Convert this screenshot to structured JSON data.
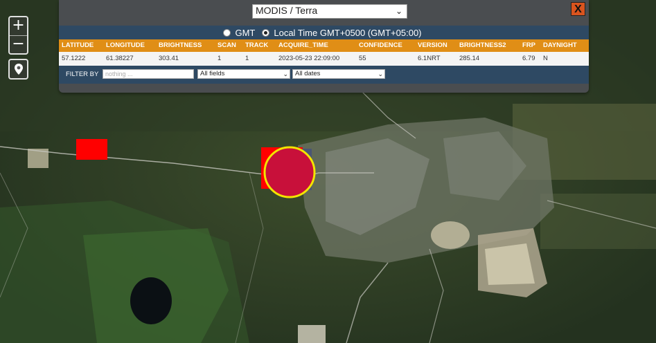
{
  "map": {
    "zoom_in_label": "+",
    "zoom_out_label": "−",
    "location_icon": "map-marker-icon",
    "fire_color": "#ff0000",
    "highlight_color": "#c8103a",
    "highlight_ring_color": "#f3e400"
  },
  "panel": {
    "source_select": "MODIS / Terra",
    "close_label": "X",
    "timezone": {
      "gmt_label": "GMT",
      "local_label": "Local Time GMT+0500 (GMT+05:00)",
      "selected": "local"
    },
    "table": {
      "headers": [
        "LATITUDE",
        "LONGITUDE",
        "BRIGHTNESS",
        "SCAN",
        "TRACK",
        "ACQUIRE_TIME",
        "CONFIDENCE",
        "VERSION",
        "BRIGHTNESS2",
        "FRP",
        "DAYNIGHT"
      ],
      "rows": [
        [
          "57.1222",
          "61.38227",
          "303.41",
          "1",
          "1",
          "2023-05-23 22:09:00",
          "55",
          "6.1NRT",
          "285.14",
          "6.79",
          "N"
        ]
      ]
    },
    "filter": {
      "label": "FILTER BY",
      "placeholder": "nothing ...",
      "fields_select": "All fields",
      "dates_select": "All dates"
    }
  }
}
